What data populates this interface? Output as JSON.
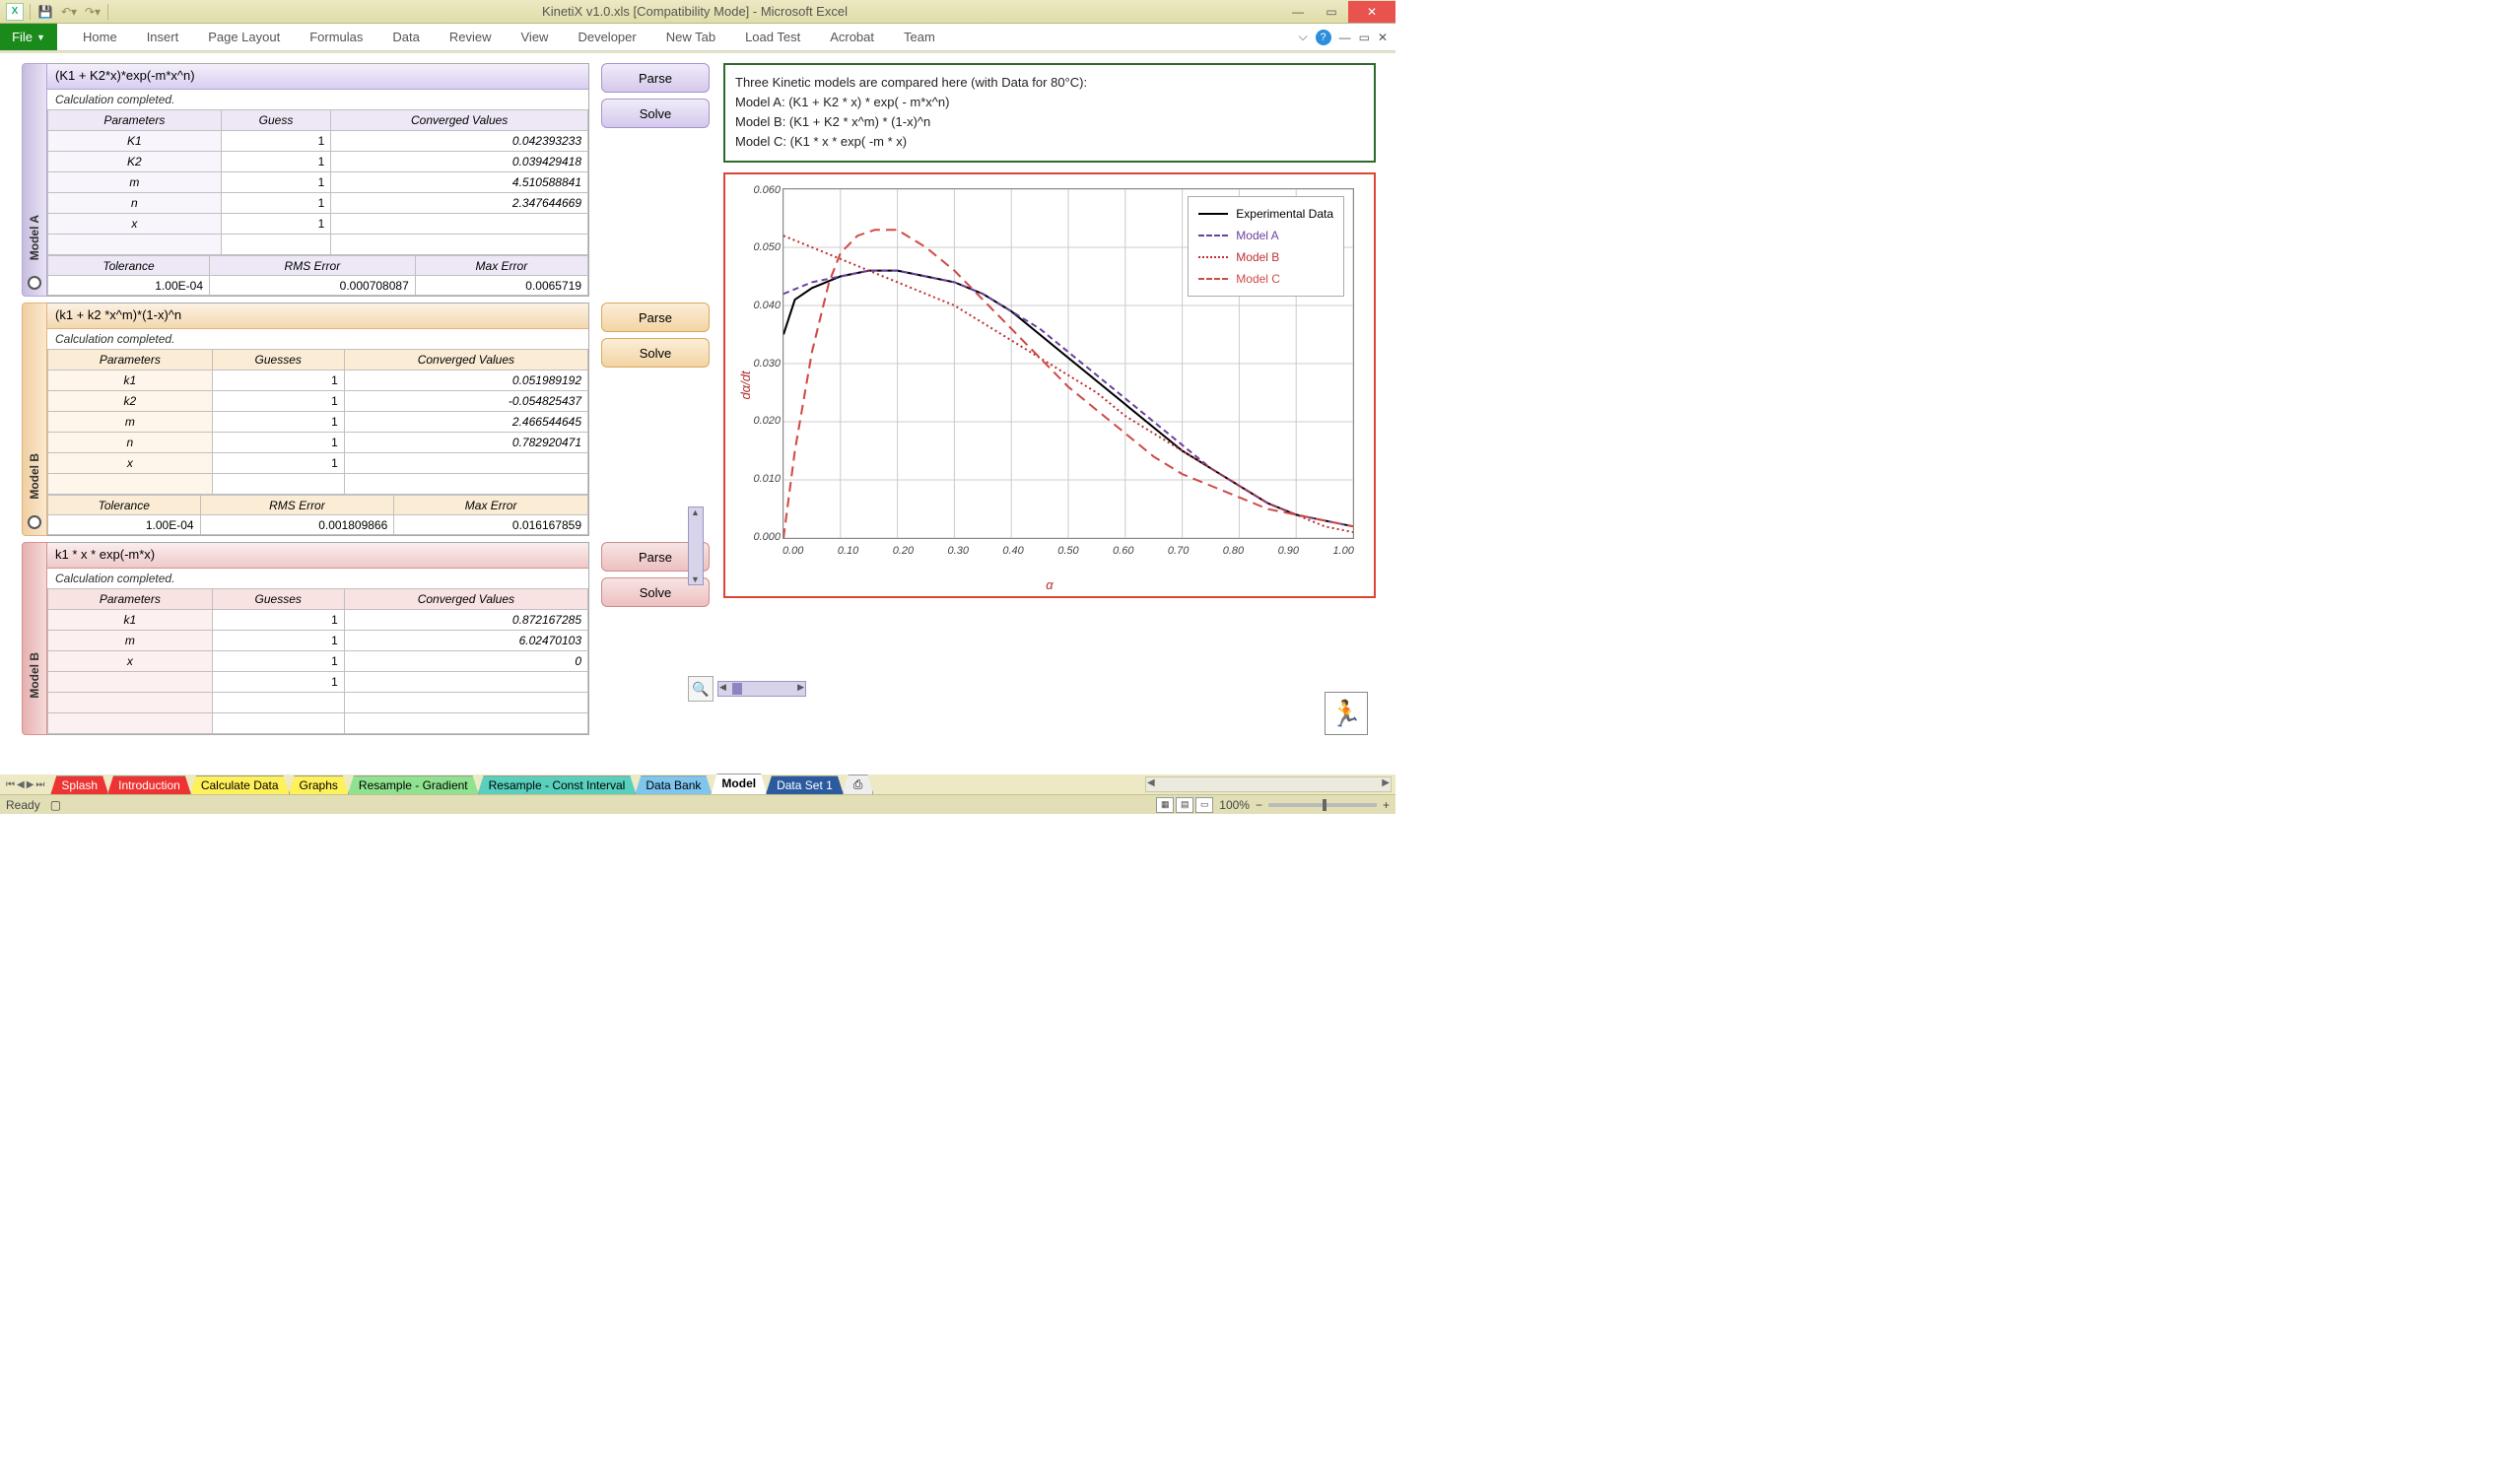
{
  "app": {
    "title": "KinetiX v1.0.xls  [Compatibility Mode]  -  Microsoft Excel",
    "file_tab": "File",
    "tabs": [
      "Home",
      "Insert",
      "Page Layout",
      "Formulas",
      "Data",
      "Review",
      "View",
      "Developer",
      "New Tab",
      "Load Test",
      "Acrobat",
      "Team"
    ]
  },
  "info_box": {
    "line1": "Three Kinetic models are compared here (with Data for 80°C):",
    "line2": "Model A: (K1 + K2 * x) * exp( - m*x^n)",
    "line3": "Model B: (K1 + K2 * x^m) * (1-x)^n",
    "line4": "Model C: (K1 * x * exp( -m * x)"
  },
  "buttons": {
    "parse": "Parse",
    "solve": "Solve"
  },
  "headers": {
    "parameters": "Parameters",
    "guess": "Guess",
    "guesses": "Guesses",
    "converged": "Converged Values",
    "tolerance": "Tolerance",
    "rms": "RMS Error",
    "max": "Max Error"
  },
  "modelA": {
    "label": "Model A",
    "formula": "(K1 + K2*x)*exp(-m*x^n)",
    "status": "Calculation completed.",
    "rows": [
      {
        "p": "K1",
        "g": "1",
        "c": "0.042393233"
      },
      {
        "p": "K2",
        "g": "1",
        "c": "0.039429418"
      },
      {
        "p": "m",
        "g": "1",
        "c": "4.510588841"
      },
      {
        "p": "n",
        "g": "1",
        "c": "2.347644669"
      },
      {
        "p": "x",
        "g": "1",
        "c": ""
      }
    ],
    "err": {
      "tol": "1.00E-04",
      "rms": "0.000708087",
      "max": "0.0065719"
    }
  },
  "modelB": {
    "label": "Model B",
    "formula": "(k1 + k2 *x^m)*(1-x)^n",
    "status": "Calculation completed.",
    "rows": [
      {
        "p": "k1",
        "g": "1",
        "c": "0.051989192"
      },
      {
        "p": "k2",
        "g": "1",
        "c": "-0.054825437"
      },
      {
        "p": "m",
        "g": "1",
        "c": "2.466544645"
      },
      {
        "p": "n",
        "g": "1",
        "c": "0.782920471"
      },
      {
        "p": "x",
        "g": "1",
        "c": ""
      }
    ],
    "err": {
      "tol": "1.00E-04",
      "rms": "0.001809866",
      "max": "0.016167859"
    }
  },
  "modelC": {
    "label": "Model B",
    "formula": "k1 * x * exp(-m*x)",
    "status": "Calculation completed.",
    "rows": [
      {
        "p": "k1",
        "g": "1",
        "c": "0.872167285"
      },
      {
        "p": "m",
        "g": "1",
        "c": "6.02470103"
      },
      {
        "p": "x",
        "g": "1",
        "c": "0"
      },
      {
        "p": "",
        "g": "1",
        "c": ""
      }
    ]
  },
  "legend": {
    "exp": "Experimental Data",
    "a": "Model A",
    "b": "Model B",
    "c": "Model C"
  },
  "axes": {
    "y": "dα/dt",
    "x": "α"
  },
  "worksheet_tabs": [
    "Splash",
    "Introduction",
    "Calculate Data",
    "Graphs",
    "Resample - Gradient",
    "Resample - Const Interval",
    "Data Bank",
    "Model",
    "Data Set 1"
  ],
  "status_bar": {
    "ready": "Ready",
    "zoom": "100%"
  },
  "chart_data": {
    "type": "line",
    "xlabel": "α",
    "ylabel": "dα/dt",
    "xlim": [
      0,
      1
    ],
    "ylim": [
      0,
      0.06
    ],
    "xticks": [
      "0.00",
      "0.10",
      "0.20",
      "0.30",
      "0.40",
      "0.50",
      "0.60",
      "0.70",
      "0.80",
      "0.90",
      "1.00"
    ],
    "yticks": [
      "0.060",
      "0.050",
      "0.040",
      "0.030",
      "0.020",
      "0.010",
      "0.000"
    ],
    "series": [
      {
        "name": "Experimental Data",
        "style": "solid",
        "color": "#000",
        "x": [
          0.0,
          0.02,
          0.05,
          0.1,
          0.15,
          0.2,
          0.25,
          0.3,
          0.35,
          0.4,
          0.45,
          0.5,
          0.55,
          0.6,
          0.65,
          0.7,
          0.75,
          0.8,
          0.85,
          0.9,
          0.95,
          1.0
        ],
        "y": [
          0.035,
          0.041,
          0.043,
          0.045,
          0.046,
          0.046,
          0.045,
          0.044,
          0.042,
          0.039,
          0.035,
          0.031,
          0.027,
          0.023,
          0.019,
          0.015,
          0.012,
          0.009,
          0.006,
          0.004,
          0.003,
          0.002
        ]
      },
      {
        "name": "Model A",
        "style": "dash",
        "color": "#6b3fa0",
        "x": [
          0.0,
          0.05,
          0.1,
          0.15,
          0.2,
          0.25,
          0.3,
          0.35,
          0.4,
          0.45,
          0.5,
          0.55,
          0.6,
          0.65,
          0.7,
          0.75,
          0.8,
          0.85,
          0.9,
          0.95,
          1.0
        ],
        "y": [
          0.042,
          0.044,
          0.045,
          0.046,
          0.046,
          0.045,
          0.044,
          0.042,
          0.039,
          0.036,
          0.032,
          0.028,
          0.024,
          0.02,
          0.016,
          0.012,
          0.009,
          0.006,
          0.004,
          0.003,
          0.002
        ]
      },
      {
        "name": "Model B",
        "style": "dot",
        "color": "#c0302f",
        "x": [
          0.0,
          0.05,
          0.1,
          0.15,
          0.2,
          0.25,
          0.3,
          0.35,
          0.4,
          0.45,
          0.5,
          0.55,
          0.6,
          0.65,
          0.7,
          0.75,
          0.8,
          0.85,
          0.9,
          0.95,
          1.0
        ],
        "y": [
          0.052,
          0.05,
          0.048,
          0.046,
          0.044,
          0.042,
          0.04,
          0.037,
          0.034,
          0.031,
          0.028,
          0.025,
          0.021,
          0.018,
          0.015,
          0.012,
          0.009,
          0.006,
          0.004,
          0.002,
          0.001
        ]
      },
      {
        "name": "Model C",
        "style": "longdash",
        "color": "#cf4a46",
        "x": [
          0.0,
          0.02,
          0.05,
          0.08,
          0.1,
          0.13,
          0.16,
          0.2,
          0.25,
          0.3,
          0.35,
          0.4,
          0.45,
          0.5,
          0.55,
          0.6,
          0.65,
          0.7,
          0.75,
          0.8,
          0.85,
          0.9,
          0.95,
          1.0
        ],
        "y": [
          0.0,
          0.015,
          0.032,
          0.044,
          0.049,
          0.052,
          0.053,
          0.053,
          0.05,
          0.046,
          0.041,
          0.036,
          0.031,
          0.026,
          0.022,
          0.018,
          0.014,
          0.011,
          0.009,
          0.007,
          0.005,
          0.004,
          0.003,
          0.002
        ]
      }
    ]
  }
}
